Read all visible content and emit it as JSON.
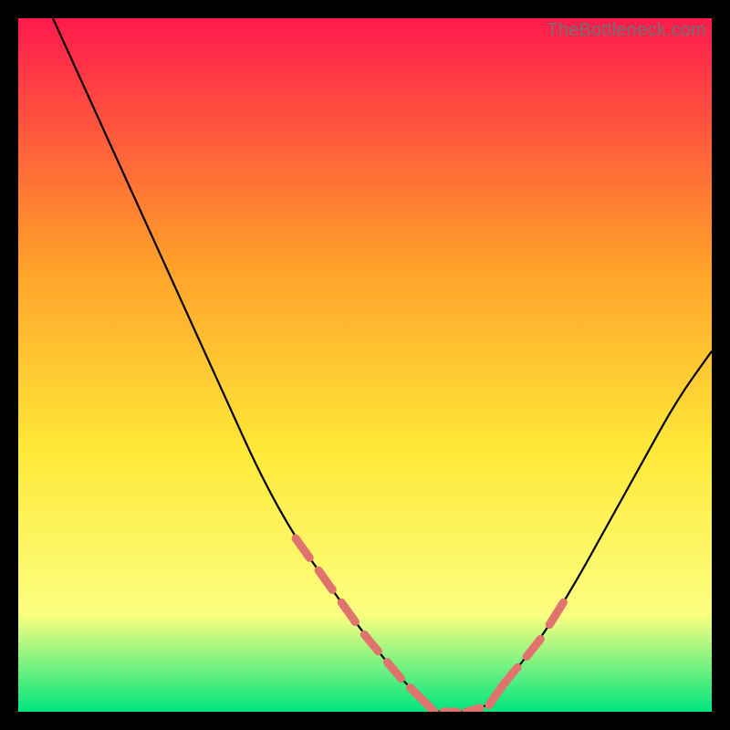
{
  "watermark": "TheBottleneck.com",
  "colors": {
    "background": "#000000",
    "gradient_top": "#ff1a4d",
    "gradient_upper_mid": "#ff9f2a",
    "gradient_mid": "#ffe838",
    "gradient_lower": "#fbff80",
    "gradient_bottom": "#00e57f",
    "curve": "#000000",
    "dash": "#e0736d",
    "watermark": "#707070"
  },
  "chart_data": {
    "type": "line",
    "title": "",
    "xlabel": "",
    "ylabel": "",
    "xlim": [
      0,
      100
    ],
    "ylim": [
      0,
      100
    ],
    "grid": false,
    "legend": false,
    "series": [
      {
        "name": "bottleneck-curve",
        "x": [
          5,
          10,
          15,
          20,
          25,
          30,
          35,
          40,
          45,
          50,
          55,
          58,
          60,
          62,
          65,
          68,
          70,
          75,
          80,
          85,
          90,
          95,
          100
        ],
        "y": [
          100,
          89,
          78,
          67,
          56,
          45,
          34,
          25,
          18,
          11,
          5,
          2,
          0,
          0,
          0,
          1,
          4,
          10,
          18,
          27,
          36,
          45,
          52
        ]
      }
    ],
    "annotations": [
      {
        "name": "dashed-region-left",
        "x_range": [
          40,
          58
        ],
        "style": "dashed",
        "color_key": "dash"
      },
      {
        "name": "dashed-region-floor",
        "x_range": [
          58,
          70
        ],
        "style": "dashed",
        "color_key": "dash"
      },
      {
        "name": "dashed-region-right",
        "x_range": [
          70,
          79
        ],
        "style": "dashed",
        "color_key": "dash"
      }
    ]
  }
}
